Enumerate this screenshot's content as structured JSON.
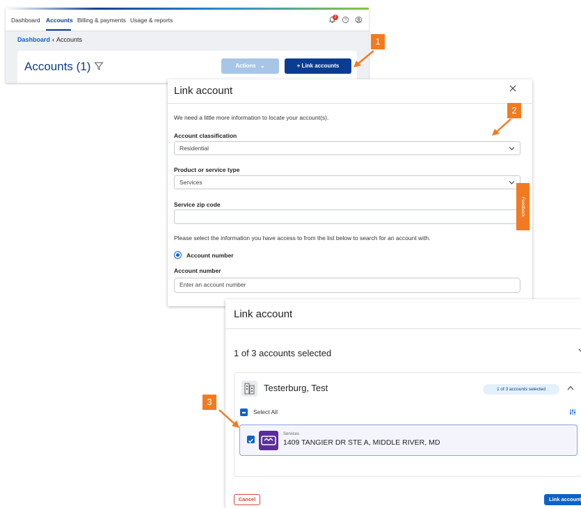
{
  "nav": {
    "items": [
      "Dashboard",
      "Accounts",
      "Billing & payments",
      "Usage & reports"
    ],
    "notification_count": "2",
    "icons": [
      "bell-icon",
      "help-icon",
      "user-icon"
    ]
  },
  "breadcrumb": {
    "link": "Dashboard",
    "current": "Accounts"
  },
  "accounts_page": {
    "title": "Accounts (1)",
    "actions_label": "Actions",
    "link_label": "+ Link accounts"
  },
  "callouts": [
    "1",
    "2",
    "3"
  ],
  "link_form": {
    "title": "Link account",
    "intro": "We need a little more information to locate your account(s).",
    "classification_label": "Account classification",
    "classification_value": "Residential",
    "product_label": "Product or service type",
    "product_value": "Services",
    "zip_label": "Service zip code",
    "zip_value": "",
    "select_info_text": "Please select the information you have access to from the list below to search for an account with.",
    "radio_option": "Account number",
    "account_number_label": "Account number",
    "account_number_placeholder": "Enter an account number",
    "feedback_label": "Feedback"
  },
  "link_select": {
    "title": "Link account",
    "selected_summary": "1 of 3 accounts selected",
    "group_name": "Testerburg, Test",
    "group_badge": "1 of 3 accounts selected",
    "select_all": "Select All",
    "account": {
      "service_type": "Services",
      "address": "1409 TANGIER DR STE A, MIDDLE RIVER, MD"
    },
    "cancel_label": "Cancel",
    "link_label": "Link accounts"
  },
  "colors": {
    "primary": "#0a3d91",
    "link": "#0a63c9",
    "callout": "#f47a20",
    "cancel": "#d64541",
    "account_logo": "#5a2ca0"
  }
}
